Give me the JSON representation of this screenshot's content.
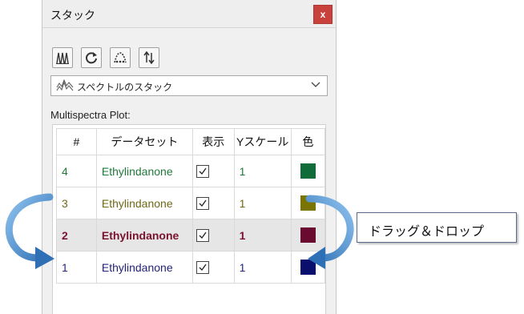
{
  "window": {
    "title": "スタック",
    "close_label": "x"
  },
  "toolbar": {
    "buttons": [
      {
        "icon": "stack-spectra-icon"
      },
      {
        "icon": "refresh-icon"
      },
      {
        "icon": "peak-icon"
      },
      {
        "icon": "sort-order-icon"
      }
    ]
  },
  "dropdown": {
    "selected": "スペクトルのスタック",
    "icon": "stack-spectra-icon"
  },
  "plot_label": "Multispectra Plot:",
  "table": {
    "headers": [
      "#",
      "データセット",
      "表示",
      "Yスケール",
      "色"
    ],
    "rows": [
      {
        "index": "4",
        "dataset": "Ethylindanone",
        "shown": true,
        "yscale": "1",
        "color": "#0f6b3a",
        "text_color": "#1f7a3a"
      },
      {
        "index": "3",
        "dataset": "Ethylindanone",
        "shown": true,
        "yscale": "1",
        "color": "#7a7400",
        "text_color": "#6e6a16"
      },
      {
        "index": "2",
        "dataset": "Ethylindanone",
        "shown": true,
        "yscale": "1",
        "color": "#6b0a30",
        "text_color": "#7a1230",
        "selected": true
      },
      {
        "index": "1",
        "dataset": "Ethylindanone",
        "shown": true,
        "yscale": "1",
        "color": "#0a0f6e",
        "text_color": "#23237a"
      }
    ]
  },
  "callout": {
    "text": "ドラッグ＆ドロップ"
  },
  "colors": {
    "arrow": "#2f6fb5",
    "arrow_light": "#7fb8e8"
  }
}
